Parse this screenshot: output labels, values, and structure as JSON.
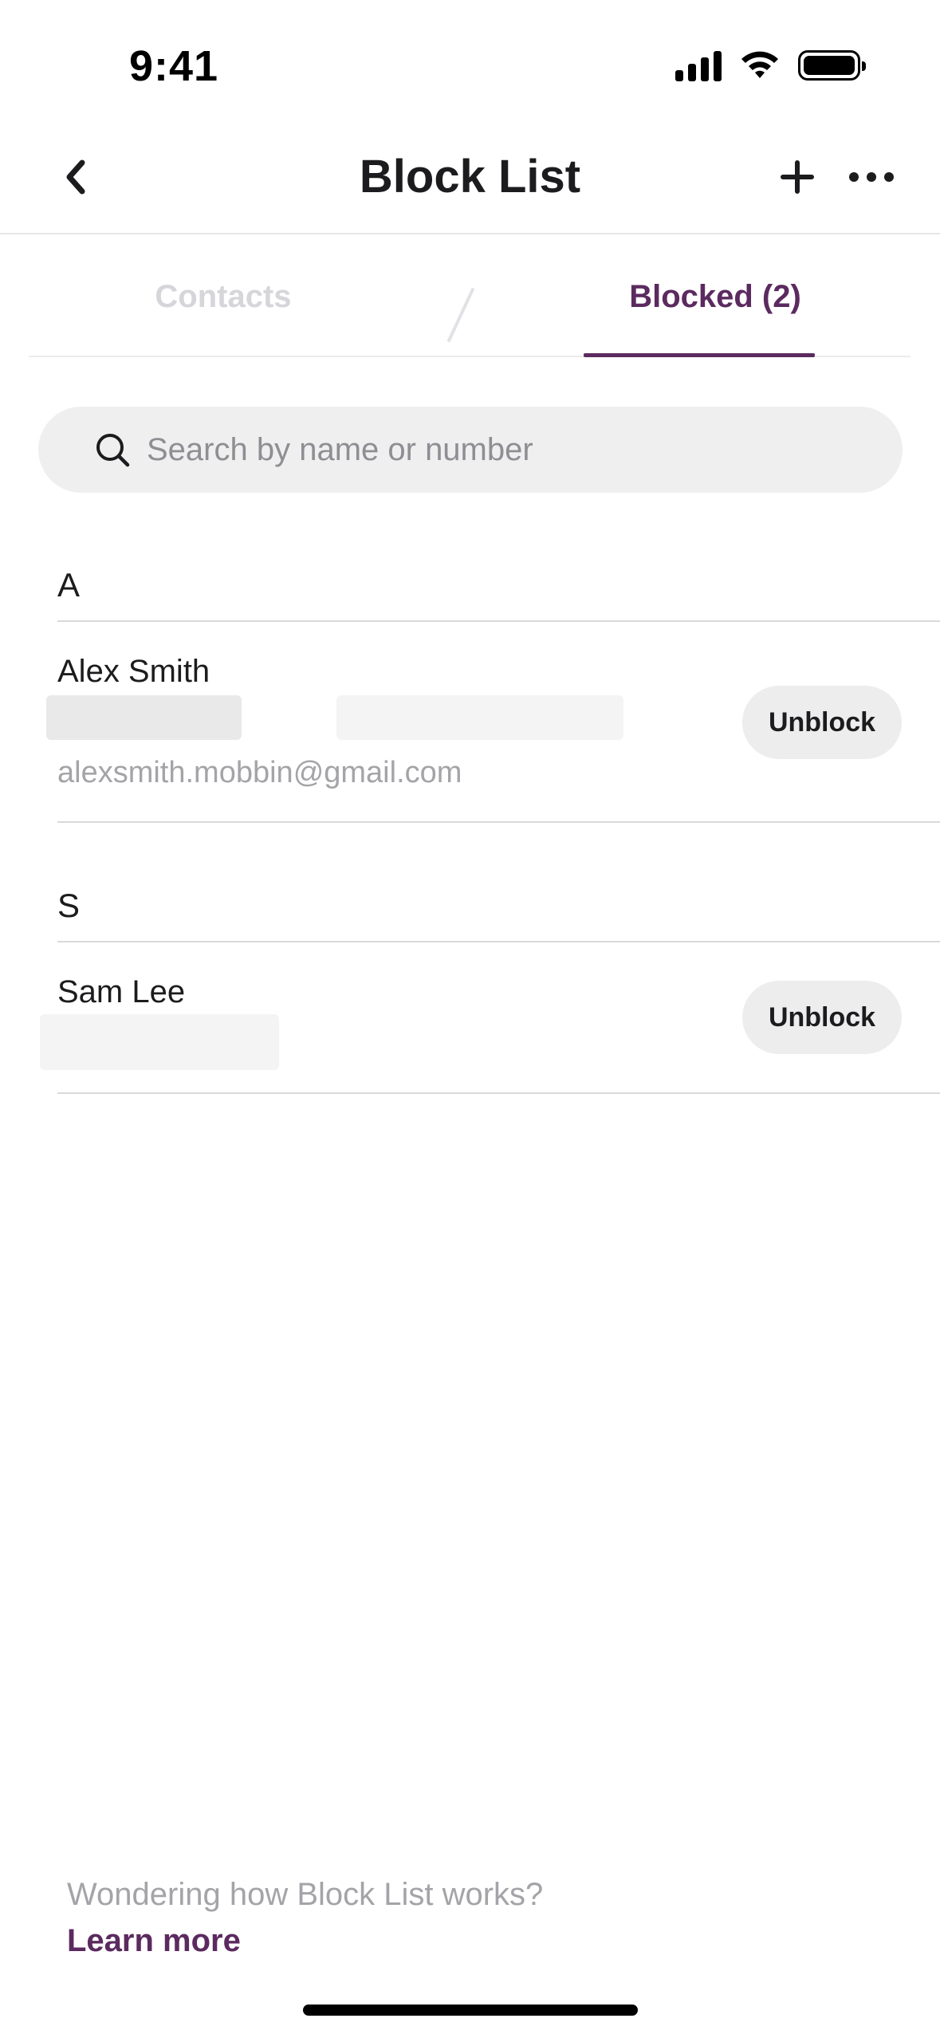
{
  "status_bar": {
    "time": "9:41"
  },
  "nav": {
    "title": "Block List"
  },
  "tabs": [
    {
      "label": "Contacts",
      "active": false
    },
    {
      "label": "Blocked (2)",
      "active": true
    }
  ],
  "search": {
    "placeholder": "Search by name or number",
    "value": ""
  },
  "sections": [
    {
      "letter": "A",
      "contacts": [
        {
          "name": "Alex Smith",
          "email": "alexsmith.mobbin@gmail.com",
          "action": "Unblock"
        }
      ]
    },
    {
      "letter": "S",
      "contacts": [
        {
          "name": "Sam Lee",
          "action": "Unblock"
        }
      ]
    }
  ],
  "footer": {
    "text": "Wondering how Block List works?",
    "link": "Learn more"
  },
  "colors": {
    "accent": "#5b2a5f",
    "inactive_tab": "#d6d6da",
    "secondary_text": "#a4a4a8"
  }
}
